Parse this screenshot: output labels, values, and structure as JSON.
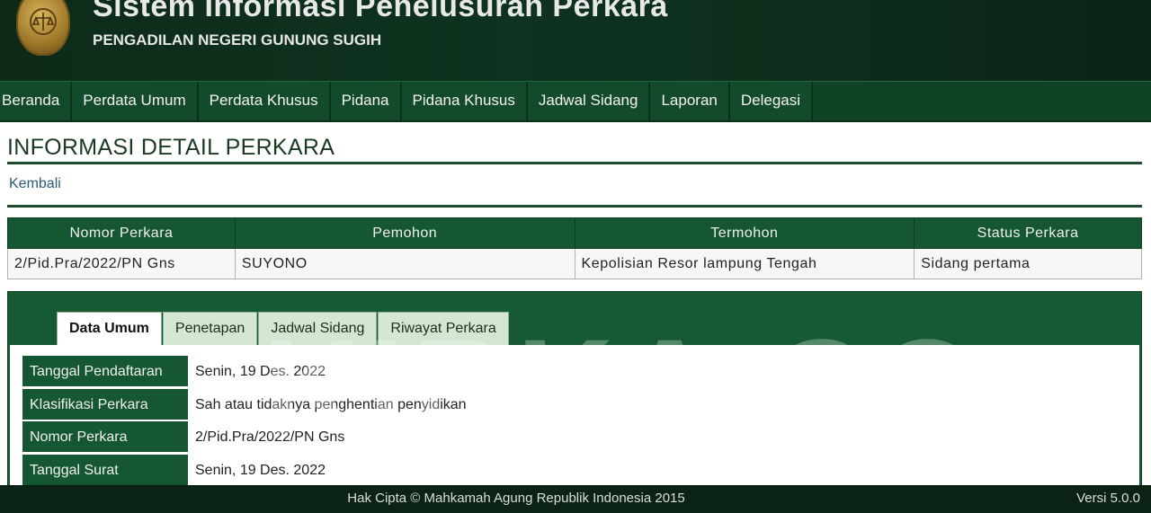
{
  "header": {
    "title": "Sistem Informasi Penelusuran Perkara",
    "subtitle": "PENGADILAN NEGERI GUNUNG SUGIH"
  },
  "nav": {
    "items": [
      {
        "label": "Beranda"
      },
      {
        "label": "Perdata Umum"
      },
      {
        "label": "Perdata Khusus"
      },
      {
        "label": "Pidana"
      },
      {
        "label": "Pidana Khusus"
      },
      {
        "label": "Jadwal Sidang"
      },
      {
        "label": "Laporan"
      },
      {
        "label": "Delegasi"
      }
    ]
  },
  "main": {
    "page_title": "INFORMASI DETAIL PERKARA",
    "back_label": "Kembali",
    "summary": {
      "headers": [
        "Nomor Perkara",
        "Pemohon",
        "Termohon",
        "Status Perkara"
      ],
      "row": [
        "2/Pid.Pra/2022/PN Gns",
        "SUYONO",
        "Kepolisian Resor lampung Tengah",
        "Sidang pertama"
      ]
    },
    "watermark": "KIRKA.CO",
    "tabs": [
      {
        "label": "Data Umum",
        "active": true
      },
      {
        "label": "Penetapan"
      },
      {
        "label": "Jadwal Sidang"
      },
      {
        "label": "Riwayat Perkara"
      }
    ],
    "details": [
      {
        "label": "Tanggal Pendaftaran",
        "value": "Senin, 19 Des. 2022"
      },
      {
        "label": "Klasifikasi Perkara",
        "value": "Sah atau tidaknya penghentian penyidikan"
      },
      {
        "label": "Nomor Perkara",
        "value": "2/Pid.Pra/2022/PN Gns"
      },
      {
        "label": "Tanggal Surat",
        "value": "Senin, 19 Des. 2022"
      }
    ]
  },
  "footer": {
    "copyright": "Hak Cipta © Mahkamah Agung Republik Indonesia 2015",
    "version": "Versi 5.0.0"
  },
  "colors": {
    "header_bg": "#0f3320",
    "nav_bg": "#124a2b",
    "accent_green": "#155732",
    "logo_gold": "#c9a04a"
  }
}
